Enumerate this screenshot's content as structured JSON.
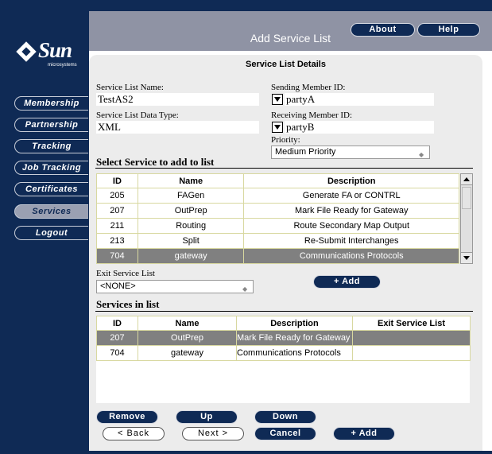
{
  "app": {
    "header_title": "Add Service List",
    "about_label": "About",
    "help_label": "Help",
    "logo_text": "Sun",
    "logo_tag": "microsystems"
  },
  "nav": {
    "items": [
      {
        "label": "Membership"
      },
      {
        "label": "Partnership"
      },
      {
        "label": "Tracking"
      },
      {
        "label": "Job Tracking"
      },
      {
        "label": "Certificates"
      },
      {
        "label": "Services"
      },
      {
        "label": "Logout"
      }
    ],
    "active": "Services"
  },
  "form": {
    "section_title": "Service List Details",
    "service_list_name_label": "Service List Name:",
    "service_list_name_value": "TestAS2",
    "service_list_data_type_label": "Service List Data Type:",
    "service_list_data_type_value": "XML",
    "sending_member_label": "Sending Member ID:",
    "sending_member_value": "partyA",
    "receiving_member_label": "Receiving Member ID:",
    "receiving_member_value": "partyB",
    "priority_label": "Priority:",
    "priority_value": "Medium Priority"
  },
  "available": {
    "heading": "Select Service to add to list",
    "columns": [
      "ID",
      "Name",
      "Description"
    ],
    "rows": [
      {
        "id": "205",
        "name": "FAGen",
        "desc": "Generate FA or CONTRL"
      },
      {
        "id": "207",
        "name": "OutPrep",
        "desc": "Mark File Ready for Gateway"
      },
      {
        "id": "211",
        "name": "Routing",
        "desc": "Route Secondary Map Output"
      },
      {
        "id": "213",
        "name": "Split",
        "desc": "Re-Submit Interchanges"
      },
      {
        "id": "704",
        "name": "gateway",
        "desc": "Communications Protocols"
      }
    ],
    "selected_row": 4
  },
  "exit": {
    "label": "Exit Service List",
    "value": "<NONE>",
    "add_label": "+ Add"
  },
  "inlist": {
    "heading": "Services in list",
    "columns": [
      "ID",
      "Name",
      "Description",
      "Exit Service List"
    ],
    "rows": [
      {
        "id": "207",
        "name": "OutPrep",
        "desc": "Mark File Ready for Gateway",
        "exit": ""
      },
      {
        "id": "704",
        "name": "gateway",
        "desc": "Communications Protocols",
        "exit": ""
      }
    ],
    "selected_row": 0
  },
  "buttons": {
    "remove": "Remove",
    "up": "Up",
    "down": "Down",
    "back": "< Back",
    "next": "Next >",
    "cancel": "Cancel",
    "add": "+ Add"
  },
  "colors": {
    "navy": "#0f2a55",
    "header_grey": "#8f93a4",
    "selected_row": "#808080"
  }
}
